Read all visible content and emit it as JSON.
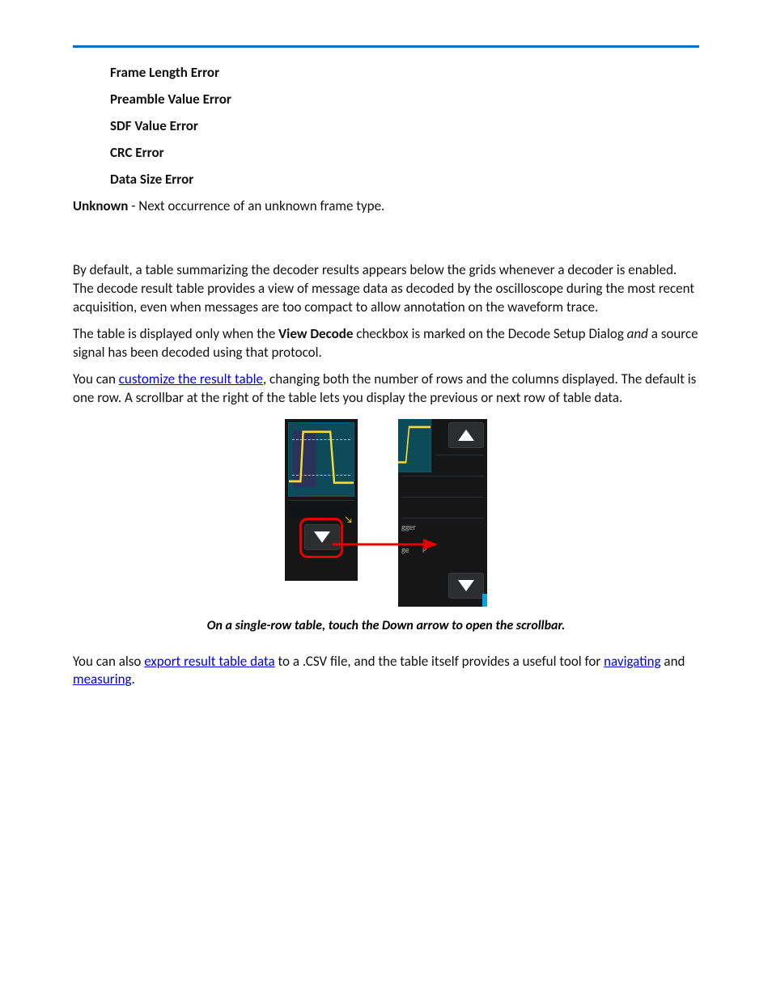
{
  "errors": {
    "e0": "Frame Length Error",
    "e1": "Preamble Value Error",
    "e2": "SDF Value Error",
    "e3": "CRC Error",
    "e4": "Data Size Error"
  },
  "unknown": {
    "label": "Unknown",
    "desc": " - Next occurrence of an unknown frame type."
  },
  "p1": "By default, a table summarizing the decoder results appears below the grids whenever a decoder is enabled. The decode result table provides a view of message data as decoded by the oscilloscope during the most recent acquisition, even when messages are too compact to allow annotation on the waveform trace.",
  "p2a": "The table is displayed only when the ",
  "p2b": "View Decode",
  "p2c": " checkbox is marked on the Decode Setup Dialog ",
  "p2d": "and",
  "p2e": " a source signal has been decoded using that protocol.",
  "p3a": "You can ",
  "link_customize": "customize the result table",
  "p3b": ", changing both the number of rows and the columns displayed. The default is one row. A scrollbar at the right of the table lets you display the previous or next row of table data.",
  "caption": "On a single-row table, touch the Down arrow to open the scrollbar.",
  "p4a": "You can also ",
  "link_export": "export result table data",
  "p4b": " to a .CSV file, and the table itself provides a useful tool for ",
  "link_nav": "navigating",
  "p4c": " and ",
  "link_meas": "measuring",
  "p4d": ".",
  "tiny1": "gger",
  "tiny2": "ge",
  "tiny3": "P"
}
